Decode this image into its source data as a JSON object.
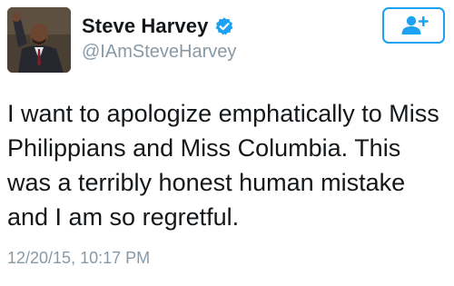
{
  "author": {
    "display_name": "Steve Harvey",
    "handle": "@IAmSteveHarvey",
    "verified": true
  },
  "icons": {
    "verified": "verified-badge-icon",
    "follow": "add-user-icon",
    "avatar": "profile-photo"
  },
  "tweet": {
    "text": "I want to apologize emphatically to Miss Philippians and Miss Columbia. This was a terribly honest human mistake and I am so regretful.",
    "timestamp": "12/20/15, 10:17 PM"
  },
  "colors": {
    "accent": "#1da1f2",
    "text": "#14171a",
    "muted": "#8899a6"
  }
}
